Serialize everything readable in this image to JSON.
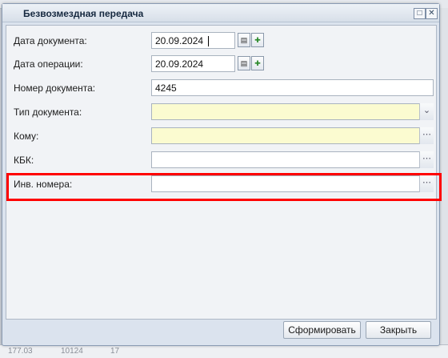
{
  "window": {
    "title": "Безвозмездная передача",
    "controls": [
      "□",
      "✕"
    ]
  },
  "form": {
    "doc_date": {
      "label": "Дата документа:",
      "value": "20.09.2024"
    },
    "op_date": {
      "label": "Дата операции:",
      "value": "20.09.2024"
    },
    "doc_number": {
      "label": "Номер документа:",
      "value": "4245"
    },
    "doc_type": {
      "label": "Тип документа:",
      "value": ""
    },
    "to_whom": {
      "label": "Кому:",
      "value": ""
    },
    "kbk": {
      "label": "КБК:",
      "value": ""
    },
    "inv_numbers": {
      "label": "Инв. номера:",
      "value": ""
    }
  },
  "buttons": {
    "generate": "Сформировать",
    "close": "Закрыть"
  },
  "background": {
    "cells": [
      "177.03",
      "10124",
      "17"
    ]
  },
  "colors": {
    "highlight": "#ff0000",
    "required_field": "#fbfbd0"
  }
}
